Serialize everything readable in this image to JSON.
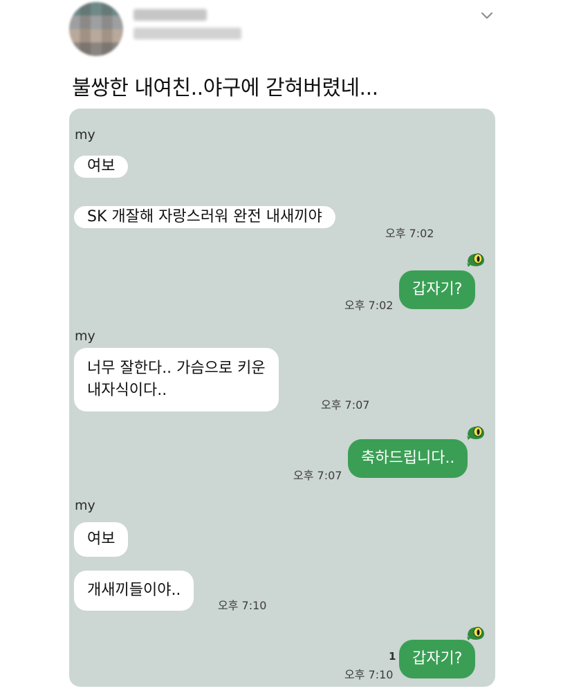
{
  "post": {
    "text": "불쌍한 내여친..야구에 갇혀버렸네..."
  },
  "chat": {
    "messages": [
      {
        "sender": "my",
        "bubbles": [
          "여보",
          "SK 개잘해 자랑스러워 완전 내새끼야"
        ],
        "time": "오후 7:02"
      },
      {
        "reply": "갑자기?",
        "time": "오후 7:02"
      },
      {
        "sender": "my",
        "bubbles": [
          "너무 잘한다.. 가슴으로 키운\n내자식이다.."
        ],
        "time": "오후 7:07"
      },
      {
        "reply": "축하드립니다..",
        "time": "오후 7:07"
      },
      {
        "sender": "my",
        "bubbles": [
          "여보",
          "개새끼들이야.."
        ],
        "time": "오후 7:10"
      },
      {
        "reply": "갑자기?",
        "time": "오후 7:10",
        "unread": "1"
      }
    ]
  },
  "colors": {
    "chat_background": "#ccd6d3",
    "outgoing_bubble": "#3a9f55",
    "incoming_bubble": "#ffffff"
  },
  "icons": [
    "chevron-down-icon",
    "frog-sticker-icon"
  ]
}
